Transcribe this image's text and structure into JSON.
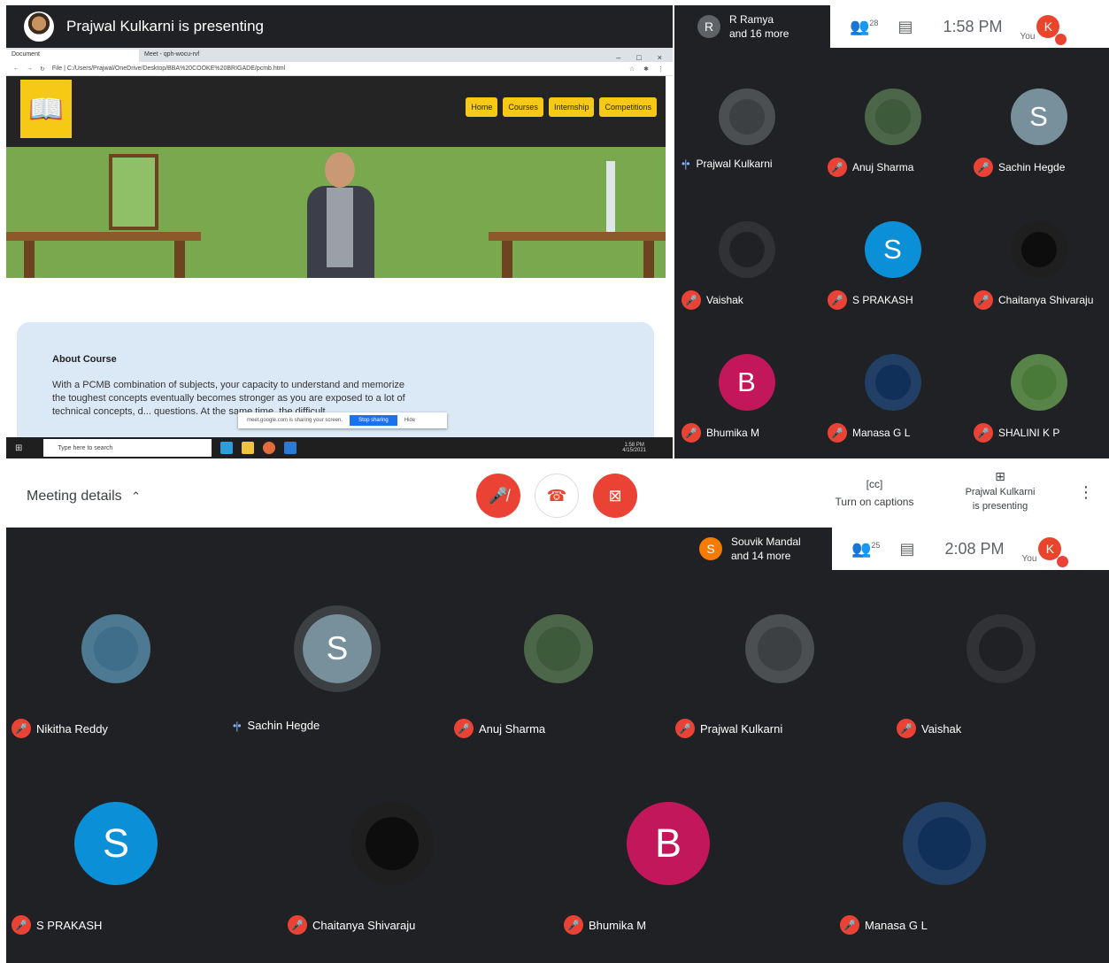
{
  "top": {
    "presenting_banner": "Prajwal Kulkarni is presenting",
    "browser": {
      "tabs": [
        "Document",
        "Meet - qph-wocu-rvf"
      ],
      "url": "File | C:/Users/Prajwal/OneDrive/Desktop/BBA%20COOKE%20BRIGADE/pcmb.html",
      "nav": [
        "Home",
        "Courses",
        "Internship",
        "Competitions"
      ],
      "about_title": "About Course",
      "about_text": "With a PCMB combination of subjects, your capacity to understand and memorize the toughest concepts eventually becomes stronger as you are exposed to a lot of technical concepts, d... questions. At the same time, the difficult...",
      "share_msg": "meet.google.com is sharing your screen.",
      "stop_share": "Stop sharing",
      "hide": "Hide",
      "taskbar_search": "Type here to search",
      "tray_time": "1:58 PM",
      "tray_date": "4/15/2021"
    },
    "bar": {
      "chip_initial": "R",
      "chip_line1": "R Ramya",
      "chip_line2": "and 16 more",
      "people_count": "28",
      "clock": "1:58 PM",
      "you": "You",
      "me_initial": "K"
    },
    "tiles": [
      {
        "name": "Prajwal Kulkarni",
        "initial": "",
        "color": "#3c4043",
        "state": "speaking"
      },
      {
        "name": "Anuj Sharma",
        "initial": "",
        "color": "#3d5a3a",
        "state": "muted"
      },
      {
        "name": "Sachin Hegde",
        "initial": "S",
        "color": "#78909c",
        "state": "muted"
      },
      {
        "name": "Vaishak",
        "initial": "",
        "color": "#202124",
        "state": "muted"
      },
      {
        "name": "S PRAKASH",
        "initial": "S",
        "color": "#0b8fd6",
        "state": "muted"
      },
      {
        "name": "Chaitanya Shivaraju",
        "initial": "",
        "color": "#0d0d0d",
        "state": "muted"
      },
      {
        "name": "Bhumika M",
        "initial": "B",
        "color": "#c2185b",
        "state": "muted"
      },
      {
        "name": "Manasa G L",
        "initial": "",
        "color": "#10305a",
        "state": "muted"
      },
      {
        "name": "SHALINI K P",
        "initial": "",
        "color": "#4a7a3a",
        "state": "muted"
      }
    ]
  },
  "controls": {
    "meeting_details": "Meeting details",
    "captions": "Turn on captions",
    "presenting_line1": "Prajwal Kulkarni",
    "presenting_line2": "is presenting"
  },
  "bottom": {
    "bar": {
      "chip_initial": "S",
      "chip_line1": "Souvik Mandal",
      "chip_line2": "and 14 more",
      "people_count": "25",
      "clock": "2:08 PM",
      "you": "You",
      "me_initial": "K"
    },
    "tiles": [
      {
        "name": "Nikitha Reddy",
        "initial": "",
        "color": "#3e6e8a",
        "state": "muted"
      },
      {
        "name": "Sachin Hegde",
        "initial": "S",
        "color": "#78909c",
        "state": "speaking"
      },
      {
        "name": "Anuj Sharma",
        "initial": "",
        "color": "#3d5a3a",
        "state": "muted"
      },
      {
        "name": "Prajwal Kulkarni",
        "initial": "",
        "color": "#3c4043",
        "state": "muted"
      },
      {
        "name": "Vaishak",
        "initial": "",
        "color": "#202124",
        "state": "muted"
      },
      {
        "name": "S PRAKASH",
        "initial": "S",
        "color": "#0b8fd6",
        "state": "muted"
      },
      {
        "name": "Chaitanya Shivaraju",
        "initial": "",
        "color": "#0d0d0d",
        "state": "muted"
      },
      {
        "name": "Bhumika M",
        "initial": "B",
        "color": "#c2185b",
        "state": "muted"
      },
      {
        "name": "Manasa G L",
        "initial": "",
        "color": "#10305a",
        "state": "muted"
      }
    ]
  }
}
